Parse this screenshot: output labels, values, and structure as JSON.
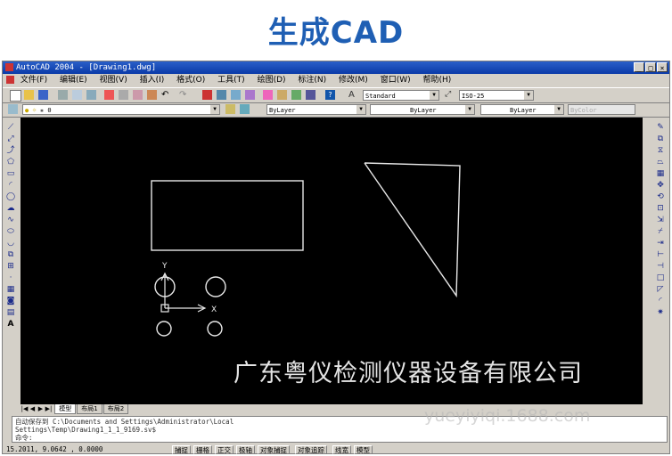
{
  "heading": "生成CAD",
  "window": {
    "title": "AutoCAD 2004 - [Drawing1.dwg]",
    "buttons": [
      "_",
      "□",
      "×"
    ]
  },
  "menu": [
    "文件(F)",
    "编辑(E)",
    "视图(V)",
    "插入(I)",
    "格式(O)",
    "工具(T)",
    "绘图(D)",
    "标注(N)",
    "修改(M)",
    "窗口(W)",
    "帮助(H)"
  ],
  "styles": {
    "text_style": "Standard",
    "dim_style": "ISO-25"
  },
  "layer": {
    "current": "0",
    "color": "ByLayer",
    "linetype": "ByLayer",
    "lineweight": "ByLayer",
    "plotstyle": "ByColor"
  },
  "ucs": {
    "y": "Y",
    "x": "X"
  },
  "tabs": [
    "模型",
    "布局1",
    "布局2"
  ],
  "command": {
    "line1": "自动保存到 C:\\Documents and Settings\\Administrator\\Local",
    "line2": "Settings\\Temp\\Drawing1_1_1_9169.sv$",
    "prompt": "命令:"
  },
  "status": {
    "coords": "15.2011, 9.0642 , 0.0000",
    "buttons": [
      "捕捉",
      "栅格",
      "正交",
      "极轴",
      "对象捕捉",
      "对象追踪",
      "线宽",
      "模型"
    ]
  },
  "overlay": {
    "company": "广东粤仪检测仪器设备有限公司",
    "watermark": "yueyiyiqi.1688.com"
  }
}
